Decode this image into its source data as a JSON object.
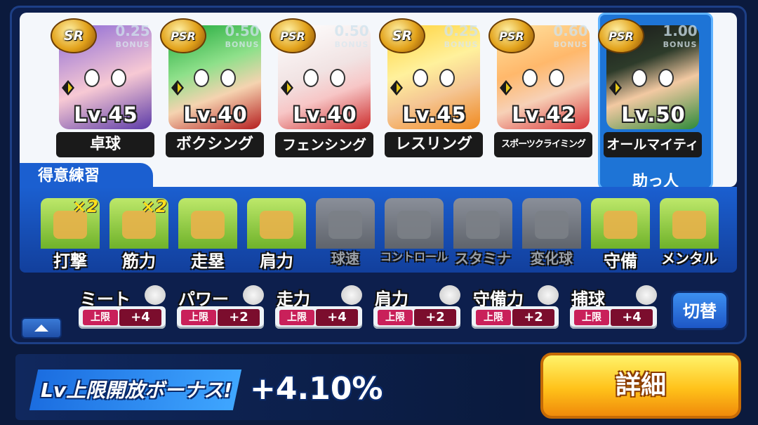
{
  "deck": {
    "cards": [
      {
        "rarity": "SR",
        "bonus": "0.25",
        "bonus_label": "BONUS",
        "level": "Lv.45",
        "name": "卓球",
        "element": "diamond-icon"
      },
      {
        "rarity": "PSR",
        "bonus": "0.50",
        "bonus_label": "BONUS",
        "level": "Lv.40",
        "name": "ボクシング",
        "element": "diamond-icon"
      },
      {
        "rarity": "PSR",
        "bonus": "0.50",
        "bonus_label": "BONUS",
        "level": "Lv.40",
        "name": "フェンシング",
        "element": "diamond-icon"
      },
      {
        "rarity": "SR",
        "bonus": "0.25",
        "bonus_label": "BONUS",
        "level": "Lv.45",
        "name": "レスリング",
        "element": "diamond-icon"
      },
      {
        "rarity": "PSR",
        "bonus": "0.60",
        "bonus_label": "BONUS",
        "level": "Lv.42",
        "name": "スポーツクライミング",
        "element": "diamond-icon"
      },
      {
        "rarity": "PSR",
        "bonus": "1.00",
        "bonus_label": "BONUS",
        "level": "Lv.50",
        "name": "オールマイティ",
        "element": "diamond-icon",
        "helper_label": "助っ人"
      }
    ]
  },
  "practice": {
    "tab_label": "得意練習",
    "items": [
      {
        "label": "打撃",
        "mult": "×2",
        "active": true,
        "icon": "bat-icon"
      },
      {
        "label": "筋力",
        "mult": "×2",
        "active": true,
        "icon": "dumbbell-icon"
      },
      {
        "label": "走塁",
        "mult": "",
        "active": true,
        "icon": "base-icon"
      },
      {
        "label": "肩力",
        "mult": "",
        "active": true,
        "icon": "throw-ball-icon"
      },
      {
        "label": "球速",
        "mult": "",
        "active": false,
        "icon": "fast-ball-icon"
      },
      {
        "label": "コントロール",
        "mult": "",
        "active": false,
        "icon": "target-icon"
      },
      {
        "label": "スタミナ",
        "mult": "",
        "active": false,
        "icon": "tire-icon"
      },
      {
        "label": "変化球",
        "mult": "",
        "active": false,
        "icon": "breaking-ball-icon"
      },
      {
        "label": "守備",
        "mult": "",
        "active": true,
        "icon": "glove-icon"
      },
      {
        "label": "メンタル",
        "mult": "",
        "active": true,
        "icon": "cloud-sparkle-icon"
      }
    ]
  },
  "bonuses": [
    {
      "label": "ミート",
      "cap": "上限",
      "value": "+4",
      "icon": "bat-icon"
    },
    {
      "label": "パワー",
      "cap": "上限",
      "value": "+2",
      "icon": "dumbbell-icon"
    },
    {
      "label": "走力",
      "cap": "上限",
      "value": "+4",
      "icon": "runner-icon"
    },
    {
      "label": "肩力",
      "cap": "上限",
      "value": "+2",
      "icon": "throw-ball-icon"
    },
    {
      "label": "守備力",
      "cap": "上限",
      "value": "+2",
      "icon": "glove-icon"
    },
    {
      "label": "捕球",
      "cap": "上限",
      "value": "+4",
      "icon": "catch-ball-icon"
    }
  ],
  "switch_label": "切替",
  "lv_bonus": {
    "label": "Lv上限開放ボーナス!",
    "value": "+4.10%"
  },
  "detail_label": "詳細"
}
